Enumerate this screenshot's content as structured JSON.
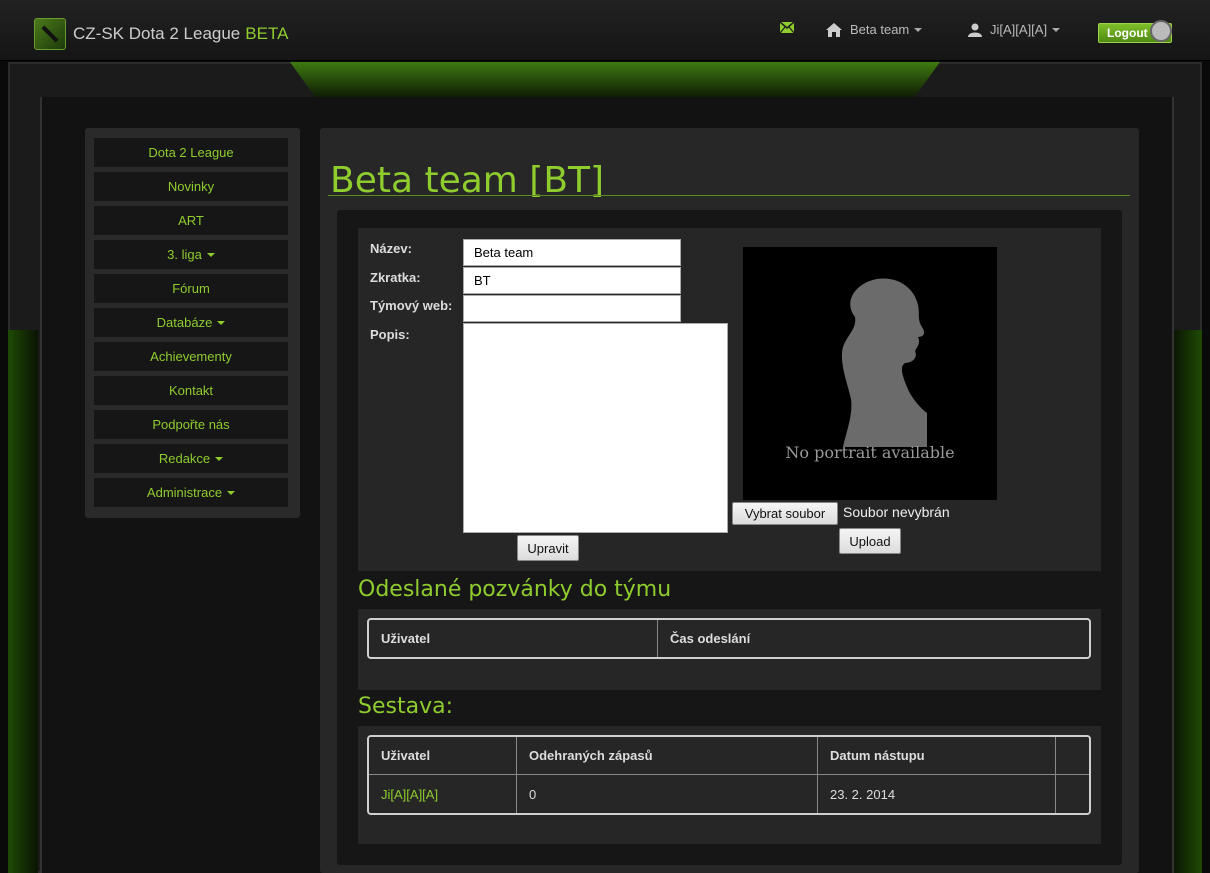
{
  "header": {
    "brand": "CZ-SK Dota 2 League",
    "brand_accent": "BETA",
    "team_menu": "Beta team",
    "user_menu": "Ji[A][A][A]",
    "logout": "Logout"
  },
  "sidebar": {
    "items": [
      {
        "label": "Dota 2 League",
        "dropdown": false
      },
      {
        "label": "Novinky",
        "dropdown": false
      },
      {
        "label": "ART",
        "dropdown": false
      },
      {
        "label": "3. liga",
        "dropdown": true
      },
      {
        "label": "Fórum",
        "dropdown": false
      },
      {
        "label": "Databáze",
        "dropdown": true
      },
      {
        "label": "Achievementy",
        "dropdown": false
      },
      {
        "label": "Kontakt",
        "dropdown": false
      },
      {
        "label": "Podpořte nás",
        "dropdown": false
      },
      {
        "label": "Redakce",
        "dropdown": true
      },
      {
        "label": "Administrace",
        "dropdown": true
      }
    ]
  },
  "page": {
    "title": "Beta team [BT]"
  },
  "form": {
    "name_label": "Název:",
    "name_value": "Beta team",
    "abbr_label": "Zkratka:",
    "abbr_value": "BT",
    "web_label": "Týmový web:",
    "web_value": "",
    "desc_label": "Popis:",
    "desc_value": "",
    "submit": "Upravit"
  },
  "portrait": {
    "text": "No portrait available",
    "choose_file": "Vybrat soubor",
    "no_file": "Soubor nevybrán",
    "upload": "Upload"
  },
  "invites": {
    "title": "Odeslané pozvánky do týmu",
    "headers": [
      "Uživatel",
      "Čas odeslání"
    ]
  },
  "roster": {
    "title": "Sestava:",
    "headers": [
      "Uživatel",
      "Odehraných zápasů",
      "Datum nástupu",
      ""
    ],
    "rows": [
      {
        "user": "Ji[A][A][A]",
        "matches": "0",
        "joined": "23. 2. 2014",
        "extra": ""
      }
    ]
  },
  "colors": {
    "accent": "#8fcc2e",
    "background": "#0a0a0a"
  }
}
